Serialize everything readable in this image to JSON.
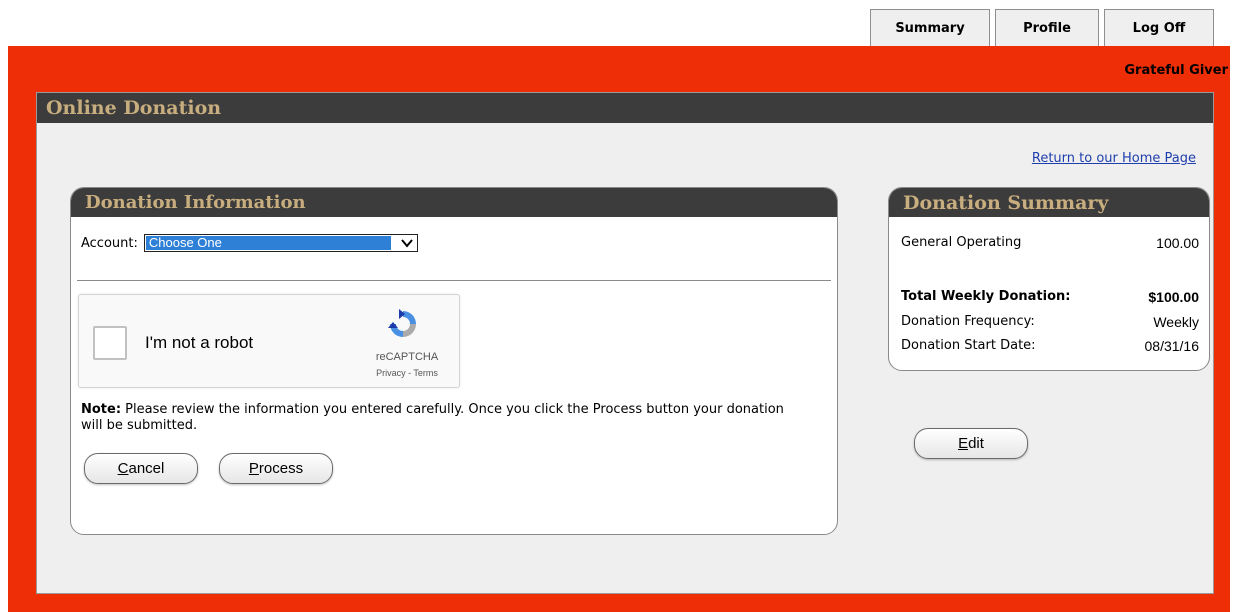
{
  "tabs": [
    {
      "label": "Summary"
    },
    {
      "label": "Profile"
    },
    {
      "label": "Log Off"
    }
  ],
  "user": {
    "name": "Grateful Giver"
  },
  "page": {
    "title": "Online Donation",
    "home_link": "Return to our Home Page"
  },
  "donation_info": {
    "title": "Donation Information",
    "account_label": "Account:",
    "account_selected": "Choose One",
    "captcha": {
      "label": "I'm not a robot",
      "brand": "reCAPTCHA",
      "links": "Privacy - Terms"
    },
    "note_bold": "Note:",
    "note_text": " Please review the information you entered carefully. Once you click the Process button your donation will be submitted.",
    "cancel_first": "C",
    "cancel_rest": "ancel",
    "process_first": "P",
    "process_rest": "rocess"
  },
  "summary": {
    "title": "Donation Summary",
    "line_item": {
      "label": "General Operating",
      "value": "100.00"
    },
    "total": {
      "label": "Total Weekly Donation:",
      "value": "$100.00"
    },
    "frequency": {
      "label": "Donation Frequency:",
      "value": "Weekly"
    },
    "start_date": {
      "label": "Donation Start Date:",
      "value": "08/31/16"
    },
    "edit_first": "E",
    "edit_rest": "dit"
  },
  "colors": {
    "frame": "#ee2e06",
    "header_bg": "#3c3c3c",
    "header_text": "#c8ae7e",
    "link": "#1f3fae",
    "select_highlight": "#2e7fd6"
  }
}
